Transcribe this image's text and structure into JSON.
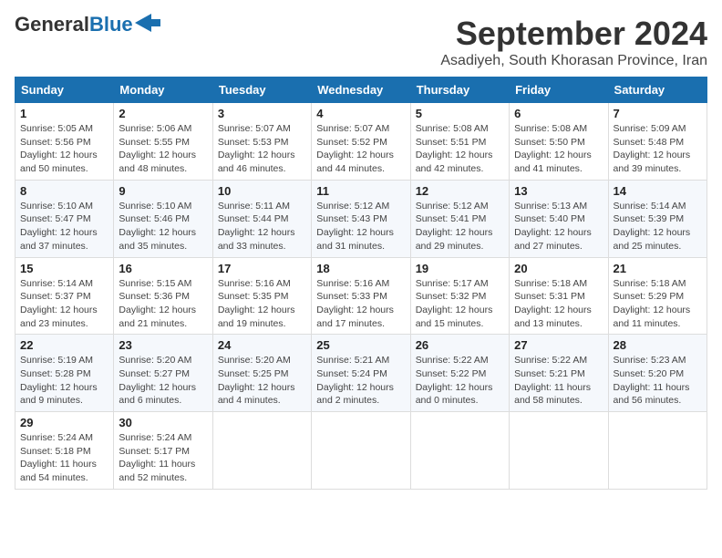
{
  "header": {
    "logo_general": "General",
    "logo_blue": "Blue",
    "month_title": "September 2024",
    "location": "Asadiyeh, South Khorasan Province, Iran"
  },
  "weekdays": [
    "Sunday",
    "Monday",
    "Tuesday",
    "Wednesday",
    "Thursday",
    "Friday",
    "Saturday"
  ],
  "weeks": [
    [
      {
        "day": "1",
        "sunrise": "5:05 AM",
        "sunset": "5:56 PM",
        "daylight": "12 hours and 50 minutes."
      },
      {
        "day": "2",
        "sunrise": "5:06 AM",
        "sunset": "5:55 PM",
        "daylight": "12 hours and 48 minutes."
      },
      {
        "day": "3",
        "sunrise": "5:07 AM",
        "sunset": "5:53 PM",
        "daylight": "12 hours and 46 minutes."
      },
      {
        "day": "4",
        "sunrise": "5:07 AM",
        "sunset": "5:52 PM",
        "daylight": "12 hours and 44 minutes."
      },
      {
        "day": "5",
        "sunrise": "5:08 AM",
        "sunset": "5:51 PM",
        "daylight": "12 hours and 42 minutes."
      },
      {
        "day": "6",
        "sunrise": "5:08 AM",
        "sunset": "5:50 PM",
        "daylight": "12 hours and 41 minutes."
      },
      {
        "day": "7",
        "sunrise": "5:09 AM",
        "sunset": "5:48 PM",
        "daylight": "12 hours and 39 minutes."
      }
    ],
    [
      {
        "day": "8",
        "sunrise": "5:10 AM",
        "sunset": "5:47 PM",
        "daylight": "12 hours and 37 minutes."
      },
      {
        "day": "9",
        "sunrise": "5:10 AM",
        "sunset": "5:46 PM",
        "daylight": "12 hours and 35 minutes."
      },
      {
        "day": "10",
        "sunrise": "5:11 AM",
        "sunset": "5:44 PM",
        "daylight": "12 hours and 33 minutes."
      },
      {
        "day": "11",
        "sunrise": "5:12 AM",
        "sunset": "5:43 PM",
        "daylight": "12 hours and 31 minutes."
      },
      {
        "day": "12",
        "sunrise": "5:12 AM",
        "sunset": "5:41 PM",
        "daylight": "12 hours and 29 minutes."
      },
      {
        "day": "13",
        "sunrise": "5:13 AM",
        "sunset": "5:40 PM",
        "daylight": "12 hours and 27 minutes."
      },
      {
        "day": "14",
        "sunrise": "5:14 AM",
        "sunset": "5:39 PM",
        "daylight": "12 hours and 25 minutes."
      }
    ],
    [
      {
        "day": "15",
        "sunrise": "5:14 AM",
        "sunset": "5:37 PM",
        "daylight": "12 hours and 23 minutes."
      },
      {
        "day": "16",
        "sunrise": "5:15 AM",
        "sunset": "5:36 PM",
        "daylight": "12 hours and 21 minutes."
      },
      {
        "day": "17",
        "sunrise": "5:16 AM",
        "sunset": "5:35 PM",
        "daylight": "12 hours and 19 minutes."
      },
      {
        "day": "18",
        "sunrise": "5:16 AM",
        "sunset": "5:33 PM",
        "daylight": "12 hours and 17 minutes."
      },
      {
        "day": "19",
        "sunrise": "5:17 AM",
        "sunset": "5:32 PM",
        "daylight": "12 hours and 15 minutes."
      },
      {
        "day": "20",
        "sunrise": "5:18 AM",
        "sunset": "5:31 PM",
        "daylight": "12 hours and 13 minutes."
      },
      {
        "day": "21",
        "sunrise": "5:18 AM",
        "sunset": "5:29 PM",
        "daylight": "12 hours and 11 minutes."
      }
    ],
    [
      {
        "day": "22",
        "sunrise": "5:19 AM",
        "sunset": "5:28 PM",
        "daylight": "12 hours and 9 minutes."
      },
      {
        "day": "23",
        "sunrise": "5:20 AM",
        "sunset": "5:27 PM",
        "daylight": "12 hours and 6 minutes."
      },
      {
        "day": "24",
        "sunrise": "5:20 AM",
        "sunset": "5:25 PM",
        "daylight": "12 hours and 4 minutes."
      },
      {
        "day": "25",
        "sunrise": "5:21 AM",
        "sunset": "5:24 PM",
        "daylight": "12 hours and 2 minutes."
      },
      {
        "day": "26",
        "sunrise": "5:22 AM",
        "sunset": "5:22 PM",
        "daylight": "12 hours and 0 minutes."
      },
      {
        "day": "27",
        "sunrise": "5:22 AM",
        "sunset": "5:21 PM",
        "daylight": "11 hours and 58 minutes."
      },
      {
        "day": "28",
        "sunrise": "5:23 AM",
        "sunset": "5:20 PM",
        "daylight": "11 hours and 56 minutes."
      }
    ],
    [
      {
        "day": "29",
        "sunrise": "5:24 AM",
        "sunset": "5:18 PM",
        "daylight": "11 hours and 54 minutes."
      },
      {
        "day": "30",
        "sunrise": "5:24 AM",
        "sunset": "5:17 PM",
        "daylight": "11 hours and 52 minutes."
      },
      null,
      null,
      null,
      null,
      null
    ]
  ],
  "labels": {
    "sunrise": "Sunrise: ",
    "sunset": "Sunset: ",
    "daylight": "Daylight: "
  }
}
